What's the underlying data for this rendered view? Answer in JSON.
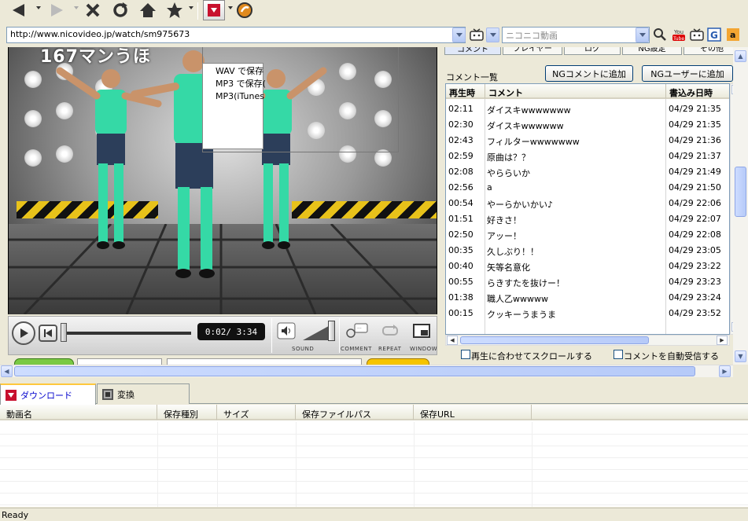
{
  "toolbar": {
    "buttons": [
      "back-icon",
      "forward-icon",
      "stop-icon",
      "reload-icon",
      "home-icon",
      "favorites-icon",
      "download-icon",
      "settings-icon"
    ]
  },
  "address": {
    "url": "http://www.nicovideo.jp/watch/sm975673",
    "search_placeholder": "ニコニコ動画"
  },
  "video": {
    "title_overlay": "167マンうほ",
    "context_menu": [
      "WAV で保存",
      "MP3 で保存(",
      "MP3(iTunes"
    ]
  },
  "player": {
    "time": "0:02/ 3:34",
    "progress": 0.01,
    "volume": 0.95,
    "labels": [
      "SOUND",
      "COMMENT",
      "REPEAT",
      "WINDOW"
    ]
  },
  "comments": {
    "tabs": [
      "コメント",
      "プレイヤー",
      "ログ",
      "NG設定",
      "その他"
    ],
    "list_title": "コメント一覧",
    "ng_comment_button": "NGコメントに追加",
    "ng_user_button": "NGユーザーに追加",
    "headers": [
      "再生時",
      "コメント",
      "書込み日時"
    ],
    "rows": [
      {
        "time": "02:11",
        "text": "ダイスキwwwwwww",
        "date": "04/29 21:35"
      },
      {
        "time": "02:30",
        "text": "ダイスキwwwwww",
        "date": "04/29 21:35"
      },
      {
        "time": "02:43",
        "text": "フィルターwwwwwww",
        "date": "04/29 21:36"
      },
      {
        "time": "02:59",
        "text": "原曲は？？",
        "date": "04/29 21:37"
      },
      {
        "time": "02:08",
        "text": "やららいか",
        "date": "04/29 21:49"
      },
      {
        "time": "02:56",
        "text": "a",
        "date": "04/29 21:50"
      },
      {
        "time": "00:54",
        "text": "やーらかいかい♪",
        "date": "04/29 22:06"
      },
      {
        "time": "01:51",
        "text": "好きさ！",
        "date": "04/29 22:07"
      },
      {
        "time": "02:50",
        "text": "アッー！",
        "date": "04/29 22:08"
      },
      {
        "time": "00:35",
        "text": "久しぶり！！",
        "date": "04/29 23:05"
      },
      {
        "time": "00:40",
        "text": "矢等名意化",
        "date": "04/29 23:22"
      },
      {
        "time": "00:55",
        "text": "らきすたを抜けー！",
        "date": "04/29 23:23"
      },
      {
        "time": "01:38",
        "text": "職人乙wwwww",
        "date": "04/29 23:24"
      },
      {
        "time": "00:15",
        "text": "クッキーうまうま",
        "date": "04/29 23:52"
      }
    ],
    "scroll_sync_label": "再生に合わせてスクロールする",
    "auto_receive_label": "コメントを自動受信する"
  },
  "bottom": {
    "tabs": [
      "ダウンロード",
      "変換"
    ],
    "headers": [
      "動画名",
      "保存種別",
      "サイズ",
      "保存ファイルパス",
      "保存URL"
    ]
  },
  "status": {
    "text": "Ready"
  }
}
